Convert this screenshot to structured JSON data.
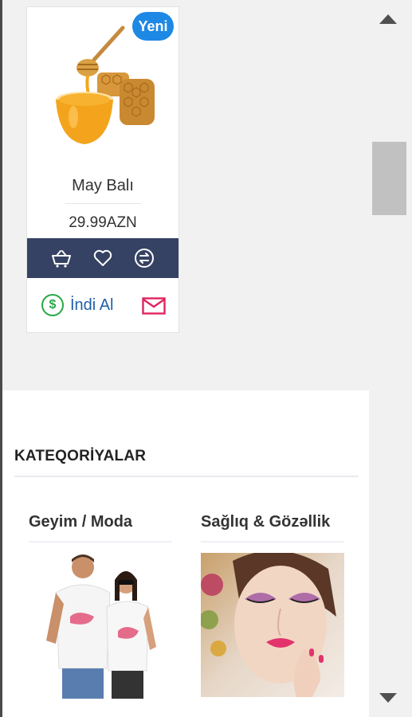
{
  "product": {
    "badge": "Yeni",
    "name": "May Balı",
    "price": "29.99AZN",
    "image_icon": "honey-image",
    "actions": [
      "cart-icon",
      "heart-icon",
      "compare-icon"
    ],
    "buy_now_label": "İndi Al",
    "buy_now_icon": "dollar-icon",
    "contact_icon": "mail-icon"
  },
  "categories": {
    "title": "KATEQORİYALAR",
    "items": [
      {
        "label": "Geyim / Moda",
        "image": "couple-tshirts-image"
      },
      {
        "label": "Sağlıq & Gözəllik",
        "image": "makeup-face-image"
      }
    ]
  },
  "colors": {
    "badge": "#1e88e5",
    "action_bar": "#364263",
    "buy_now_text": "#1f5fa8",
    "dollar_green": "#27a845",
    "mail_red": "#e0245e"
  }
}
